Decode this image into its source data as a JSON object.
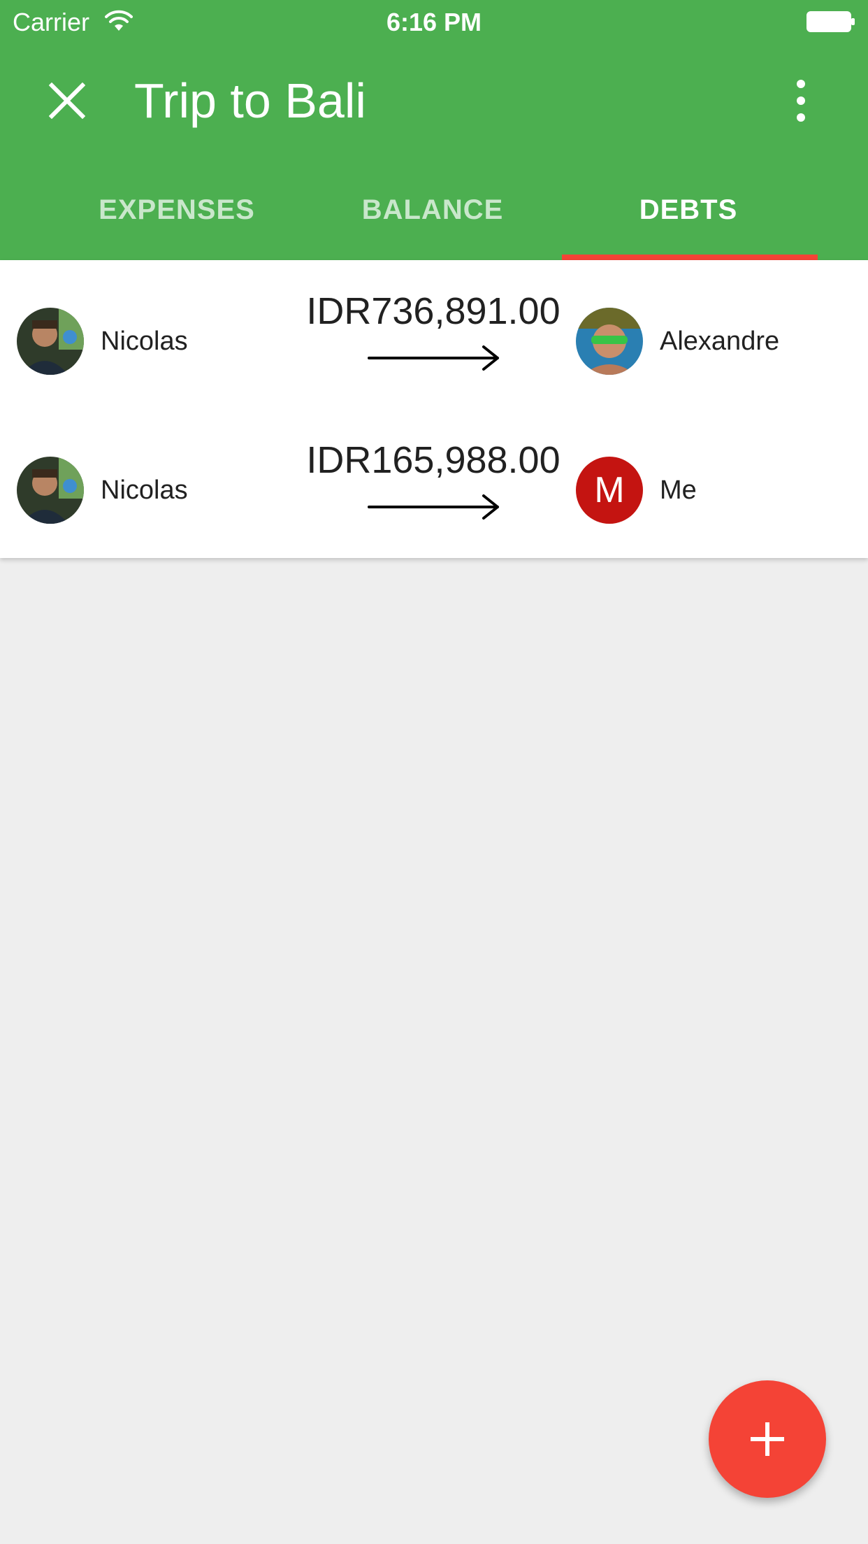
{
  "status_bar": {
    "carrier": "Carrier",
    "time": "6:16 PM",
    "icons": [
      "wifi-icon",
      "battery-icon"
    ]
  },
  "app_bar": {
    "title": "Trip to Bali",
    "close_icon": "close-icon",
    "menu_icon": "more-vert-icon",
    "color": "#4caf50"
  },
  "tabs": [
    {
      "label": "EXPENSES",
      "active": false
    },
    {
      "label": "BALANCE",
      "active": false
    },
    {
      "label": "DEBTS",
      "active": true
    }
  ],
  "tab_indicator_color": "#f44336",
  "debts": [
    {
      "from": "Nicolas",
      "amount": "IDR736,891.00",
      "to": "Alexandre"
    },
    {
      "from": "Nicolas",
      "amount": "IDR165,988.00",
      "to": "Me",
      "to_initial": "M",
      "to_avatar_color": "#c41411"
    }
  ],
  "fab": {
    "icon": "plus-icon",
    "color": "#f44336"
  }
}
